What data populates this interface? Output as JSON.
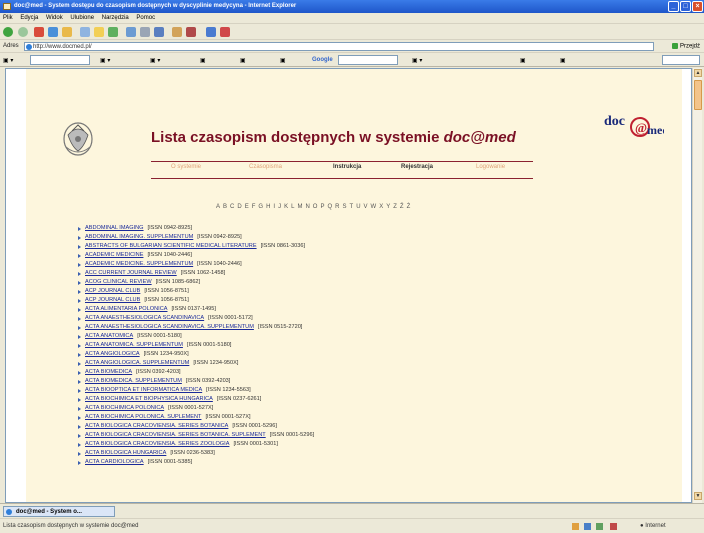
{
  "window": {
    "title": "doc@med - System dostępu do czasopism dostępnych w dyscyplinie medycyna - Internet Explorer"
  },
  "menu": [
    "Plik",
    "Edycja",
    "Widok",
    "Ulubione",
    "Narzędzia",
    "Pomoc"
  ],
  "address": {
    "label": "Adres",
    "url": "http://www.docmed.pl/",
    "go_label": "Przejdź"
  },
  "links": {
    "search_engine_label": "Google"
  },
  "page": {
    "title_prefix": "Lista czasopism dostępnych w systemie ",
    "title_brand": "doc@med",
    "logo_text": "doc@med",
    "nav": [
      "O systemie",
      "Czasopisma",
      "Instrukcja",
      "Rejestracja",
      "Logowanie"
    ],
    "alphabet": [
      "A",
      "B",
      "C",
      "D",
      "E",
      "F",
      "G",
      "H",
      "I",
      "J",
      "K",
      "L",
      "M",
      "N",
      "O",
      "P",
      "Q",
      "R",
      "S",
      "T",
      "U",
      "V",
      "W",
      "X",
      "Y",
      "Z",
      "Ź",
      "Ż"
    ]
  },
  "journals": [
    {
      "name": "ABDOMINAL IMAGING",
      "issn": "[ISSN 0942-8925]"
    },
    {
      "name": "ABDOMINAL IMAGING. SUPPLEMENTUM",
      "issn": "[ISSN 0942-8925]"
    },
    {
      "name": "ABSTRACTS OF BULGARIAN SCIENTIFIC MEDICAL LITERATURE",
      "issn": "[ISSN 0861-3036]"
    },
    {
      "name": "ACADEMIC MEDICINE",
      "issn": "[ISSN 1040-2446]"
    },
    {
      "name": "ACADEMIC MEDICINE. SUPPLEMENTUM",
      "issn": "[ISSN 1040-2446]"
    },
    {
      "name": "ACC CURRENT JOURNAL REVIEW",
      "issn": "[ISSN 1062-1458]"
    },
    {
      "name": "ACOG CLINICAL REVIEW",
      "issn": "[ISSN 1085-6862]"
    },
    {
      "name": "ACP JOURNAL CLUB",
      "issn": "[ISSN 1056-8751]"
    },
    {
      "name": "ACP JOURNAL CLUB",
      "issn": "[ISSN 1056-8751]"
    },
    {
      "name": "ACTA ALIMENTARIA POLONICA",
      "issn": "[ISSN 0137-1495]"
    },
    {
      "name": "ACTA ANAESTHESIOLOGICA SCANDINAVICA",
      "issn": "[ISSN 0001-5172]"
    },
    {
      "name": "ACTA ANAESTHESIOLOGICA SCANDINAVICA. SUPPLEMENTUM",
      "issn": "[ISSN 0515-2720]"
    },
    {
      "name": "ACTA ANATOMICA",
      "issn": "[ISSN 0001-5180]"
    },
    {
      "name": "ACTA ANATOMICA. SUPPLEMENTUM",
      "issn": "[ISSN 0001-5180]"
    },
    {
      "name": "ACTA ANGIOLOGICA",
      "issn": "[ISSN 1234-950X]"
    },
    {
      "name": "ACTA ANGIOLOGICA. SUPPLEMENTUM",
      "issn": "[ISSN 1234-950X]"
    },
    {
      "name": "ACTA BIOMEDICA",
      "issn": "[ISSN 0392-4203]"
    },
    {
      "name": "ACTA BIOMEDICA. SUPPLEMENTUM",
      "issn": "[ISSN 0392-4203]"
    },
    {
      "name": "ACTA BIOOPTICA ET INFORMATICA MEDICA",
      "issn": "[ISSN 1234-5563]"
    },
    {
      "name": "ACTA BIOCHIMICA ET BIOPHYSICA HUNGARICA",
      "issn": "[ISSN 0237-6261]"
    },
    {
      "name": "ACTA BIOCHIMICA POLONICA",
      "issn": "[ISSN 0001-527X]"
    },
    {
      "name": "ACTA BIOCHIMICA POLONICA. SUPLEMENT",
      "issn": "[ISSN 0001-527X]"
    },
    {
      "name": "ACTA BIOLOGICA CRACOVIENSIA. SERIES BOTANICA",
      "issn": "[ISSN 0001-5296]"
    },
    {
      "name": "ACTA BIOLOGICA CRACOVIENSIA. SERIES BOTANICA. SUPLEMENT",
      "issn": "[ISSN 0001-5296]"
    },
    {
      "name": "ACTA BIOLOGICA CRACOVIENSIA. SERIES ZOOLOGIA",
      "issn": "[ISSN 0001-5301]"
    },
    {
      "name": "ACTA BIOLOGICA HUNGARICA",
      "issn": "[ISSN 0236-5383]"
    },
    {
      "name": "ACTA CARDIOLOGICA",
      "issn": "[ISSN 0001-5385]"
    }
  ],
  "taskbar": {
    "item_label": "doc@med - System o..."
  },
  "status": {
    "text": "Lista czasopism dostępnych w systemie doc@med",
    "zone": "Internet"
  }
}
